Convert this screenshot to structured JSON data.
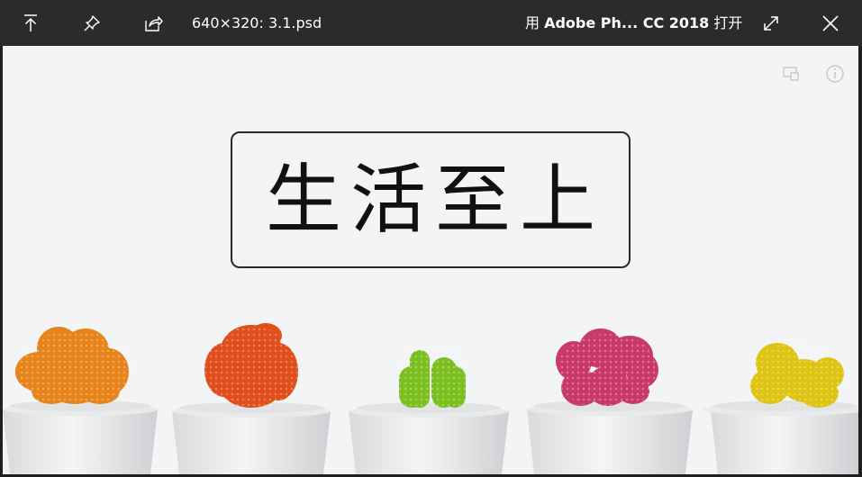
{
  "titlebar": {
    "file_label": "640×320: 3.1.psd",
    "open_prefix": "用 ",
    "open_app": "Adobe Ph... CC 2018",
    "open_suffix": " 打开",
    "icons": [
      "upload-icon",
      "pin-icon",
      "share-icon",
      "expand-icon",
      "close-icon"
    ]
  },
  "viewer": {
    "caption": "生活至上",
    "overlay_icons": [
      "cast-icon",
      "info-icon"
    ]
  },
  "colors": {
    "titlebar_bg": "#2b2b2b",
    "canvas_bg": "#f3f4f6",
    "cactus": [
      "#e8841c",
      "#e1501c",
      "#7cbf21",
      "#c93a6a",
      "#e0c414"
    ]
  }
}
